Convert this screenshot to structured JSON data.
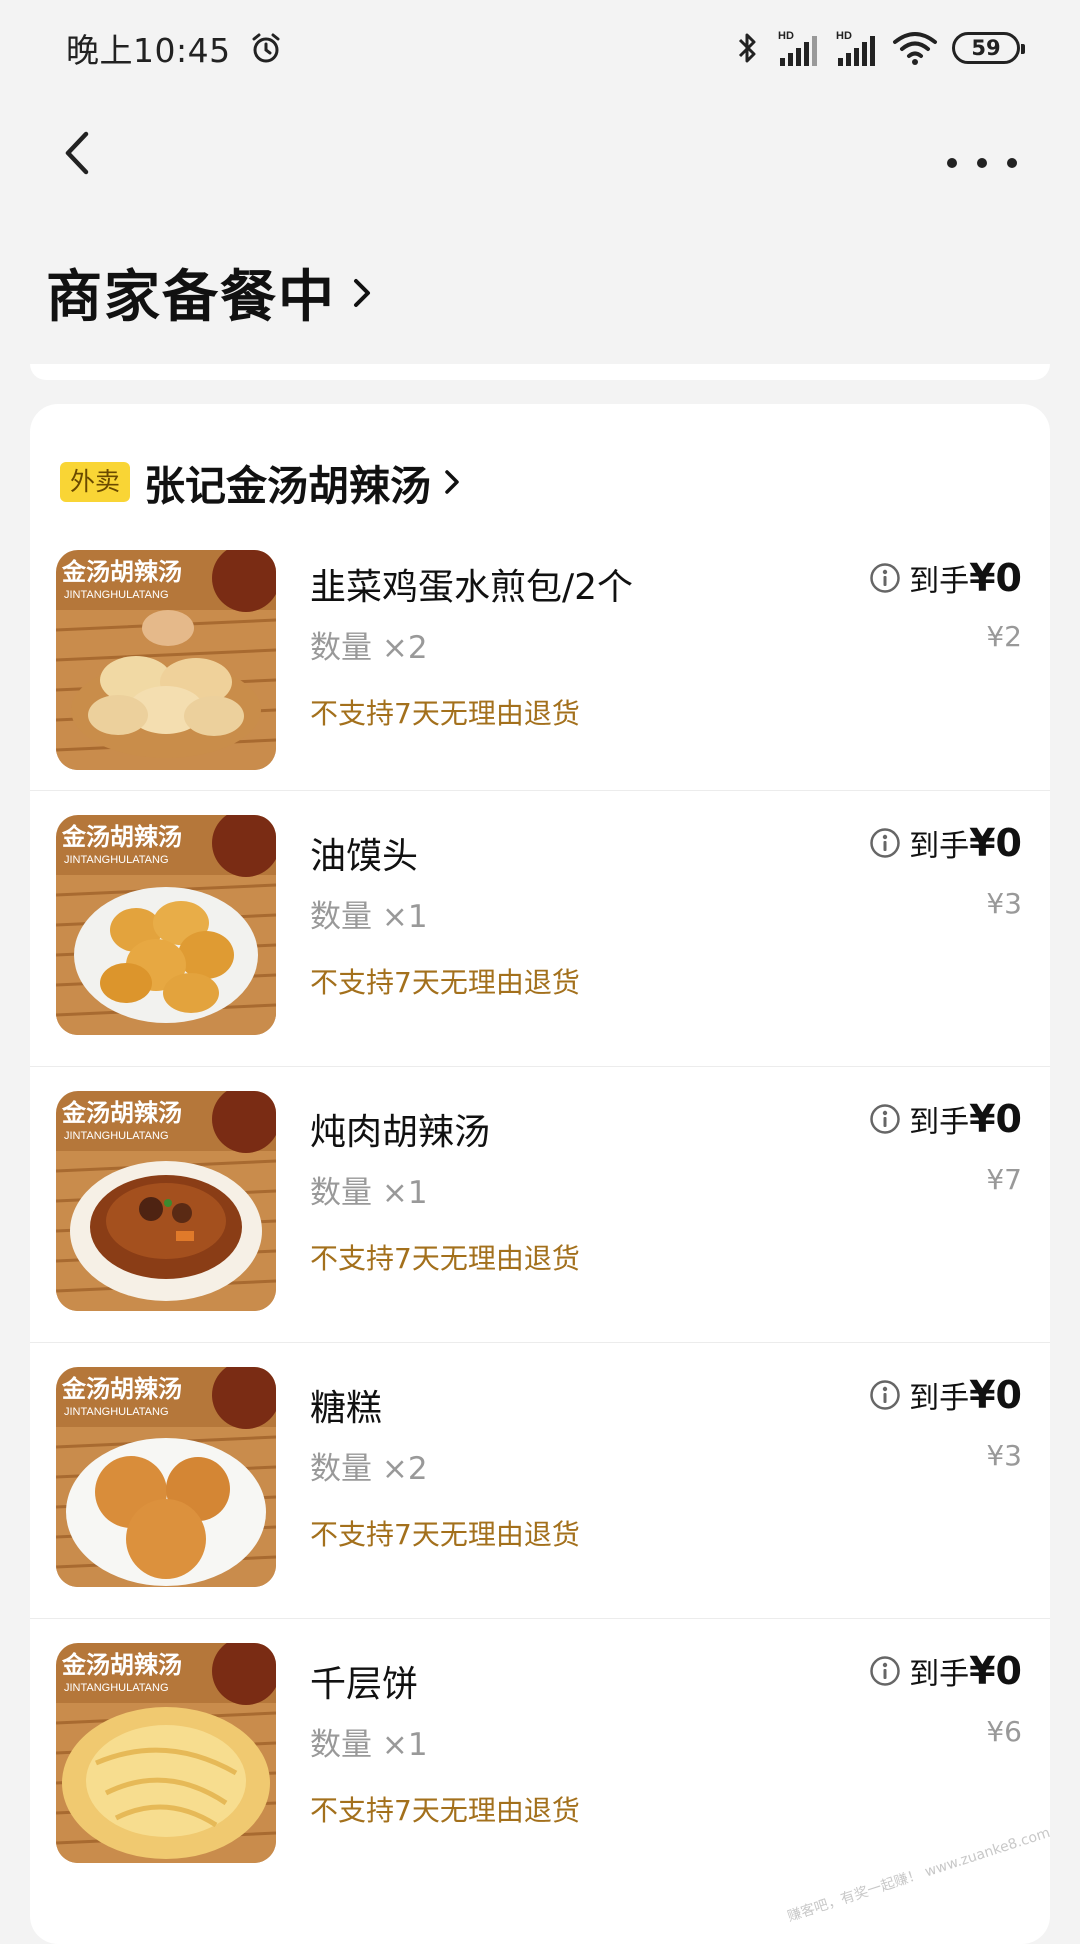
{
  "status_bar": {
    "time": "晚上10:45",
    "battery": "59"
  },
  "header": {
    "title": "商家备餐中"
  },
  "store": {
    "tag": "外卖",
    "name": "张记金汤胡辣汤"
  },
  "items": [
    {
      "name": "韭菜鸡蛋水煎包/2个",
      "qty": "数量 ×2",
      "policy": "不支持7天无理由退货",
      "net_label": "到手",
      "net_value": "¥0",
      "orig_price": "¥2",
      "thumb_brand": "金汤胡辣汤",
      "thumb_brand_sub": "JINTANGHULATANG"
    },
    {
      "name": "油馍头",
      "qty": "数量 ×1",
      "policy": "不支持7天无理由退货",
      "net_label": "到手",
      "net_value": "¥0",
      "orig_price": "¥3",
      "thumb_brand": "金汤胡辣汤",
      "thumb_brand_sub": "JINTANGHULATANG"
    },
    {
      "name": "炖肉胡辣汤",
      "qty": "数量 ×1",
      "policy": "不支持7天无理由退货",
      "net_label": "到手",
      "net_value": "¥0",
      "orig_price": "¥7",
      "thumb_brand": "金汤胡辣汤",
      "thumb_brand_sub": "JINTANGHULATANG"
    },
    {
      "name": "糖糕",
      "qty": "数量 ×2",
      "policy": "不支持7天无理由退货",
      "net_label": "到手",
      "net_value": "¥0",
      "orig_price": "¥3",
      "thumb_brand": "金汤胡辣汤",
      "thumb_brand_sub": "JINTANGHULATANG"
    },
    {
      "name": "千层饼",
      "qty": "数量 ×1",
      "policy": "不支持7天无理由退货",
      "net_label": "到手",
      "net_value": "¥0",
      "orig_price": "¥6",
      "thumb_brand": "金汤胡辣汤",
      "thumb_brand_sub": "JINTANGHULATANG"
    }
  ],
  "watermark": "赚客吧，有奖一起赚！ www.zuanke8.com",
  "colors": {
    "accent_tag": "#f9d535",
    "policy_text": "#a3701c",
    "background": "#f3f3f3"
  },
  "icons": [
    "alarm-icon",
    "bluetooth-icon",
    "signal-icon",
    "wifi-icon",
    "back-arrow-icon",
    "more-icon",
    "chevron-right-icon",
    "info-icon"
  ]
}
